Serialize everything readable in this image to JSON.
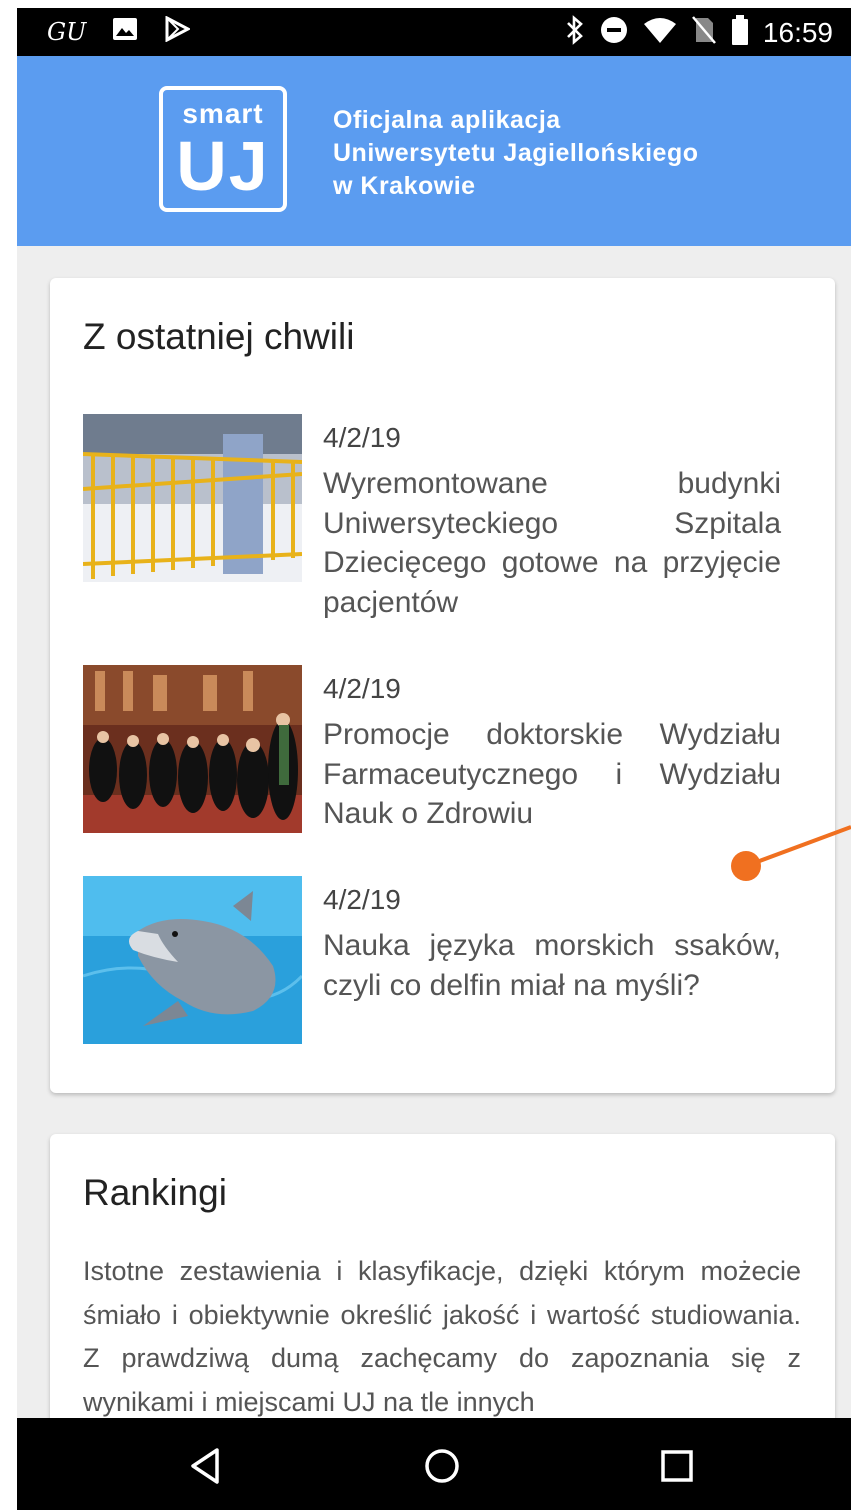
{
  "status_bar": {
    "carrier": "GU",
    "time": "16:59",
    "left_icons": [
      "image-icon",
      "play-store-icon"
    ],
    "right_icons": [
      "bluetooth-icon",
      "do-not-disturb-icon",
      "wifi-icon",
      "no-sim-icon",
      "battery-icon"
    ]
  },
  "header": {
    "logo_top": "smart",
    "logo_bottom": "UJ",
    "line1": "Oficjalna aplikacja",
    "line2": "Uniwersytetu Jagiellońskiego",
    "line3": "w Krakowie",
    "background_color": "#5b9cf0"
  },
  "news": {
    "title": "Z ostatniej chwili",
    "items": [
      {
        "date": "4/2/19",
        "title": "Wyremontowane budynki Uniwersyteckiego Szpitala Dziecięcego gotowe na przyjęcie pacjentów",
        "image": "hospital-cribs-photo"
      },
      {
        "date": "4/2/19",
        "title": "Promocje doktorskie Wydziału Farmaceutycznego i Wydziału Nauk o Zdrowiu",
        "image": "graduation-ceremony-photo"
      },
      {
        "date": "4/2/19",
        "title": "Nauka języka morskich ssaków, czyli co delfin miał na myśli?",
        "image": "dolphin-photo"
      }
    ]
  },
  "rankings": {
    "title": "Rankingi",
    "text": "Istotne zestawienia i klasyfikacje, dzięki którym możecie śmiało i obiektywnie określić jakość i wartość studiowania. Z prawdziwą dumą zachęcamy do zapoznania się z wynikami i miejscami UJ na tle innych"
  },
  "annotation_color": "#f07020",
  "nav_bar": {
    "buttons": [
      "back-icon",
      "home-icon",
      "recents-icon"
    ]
  }
}
